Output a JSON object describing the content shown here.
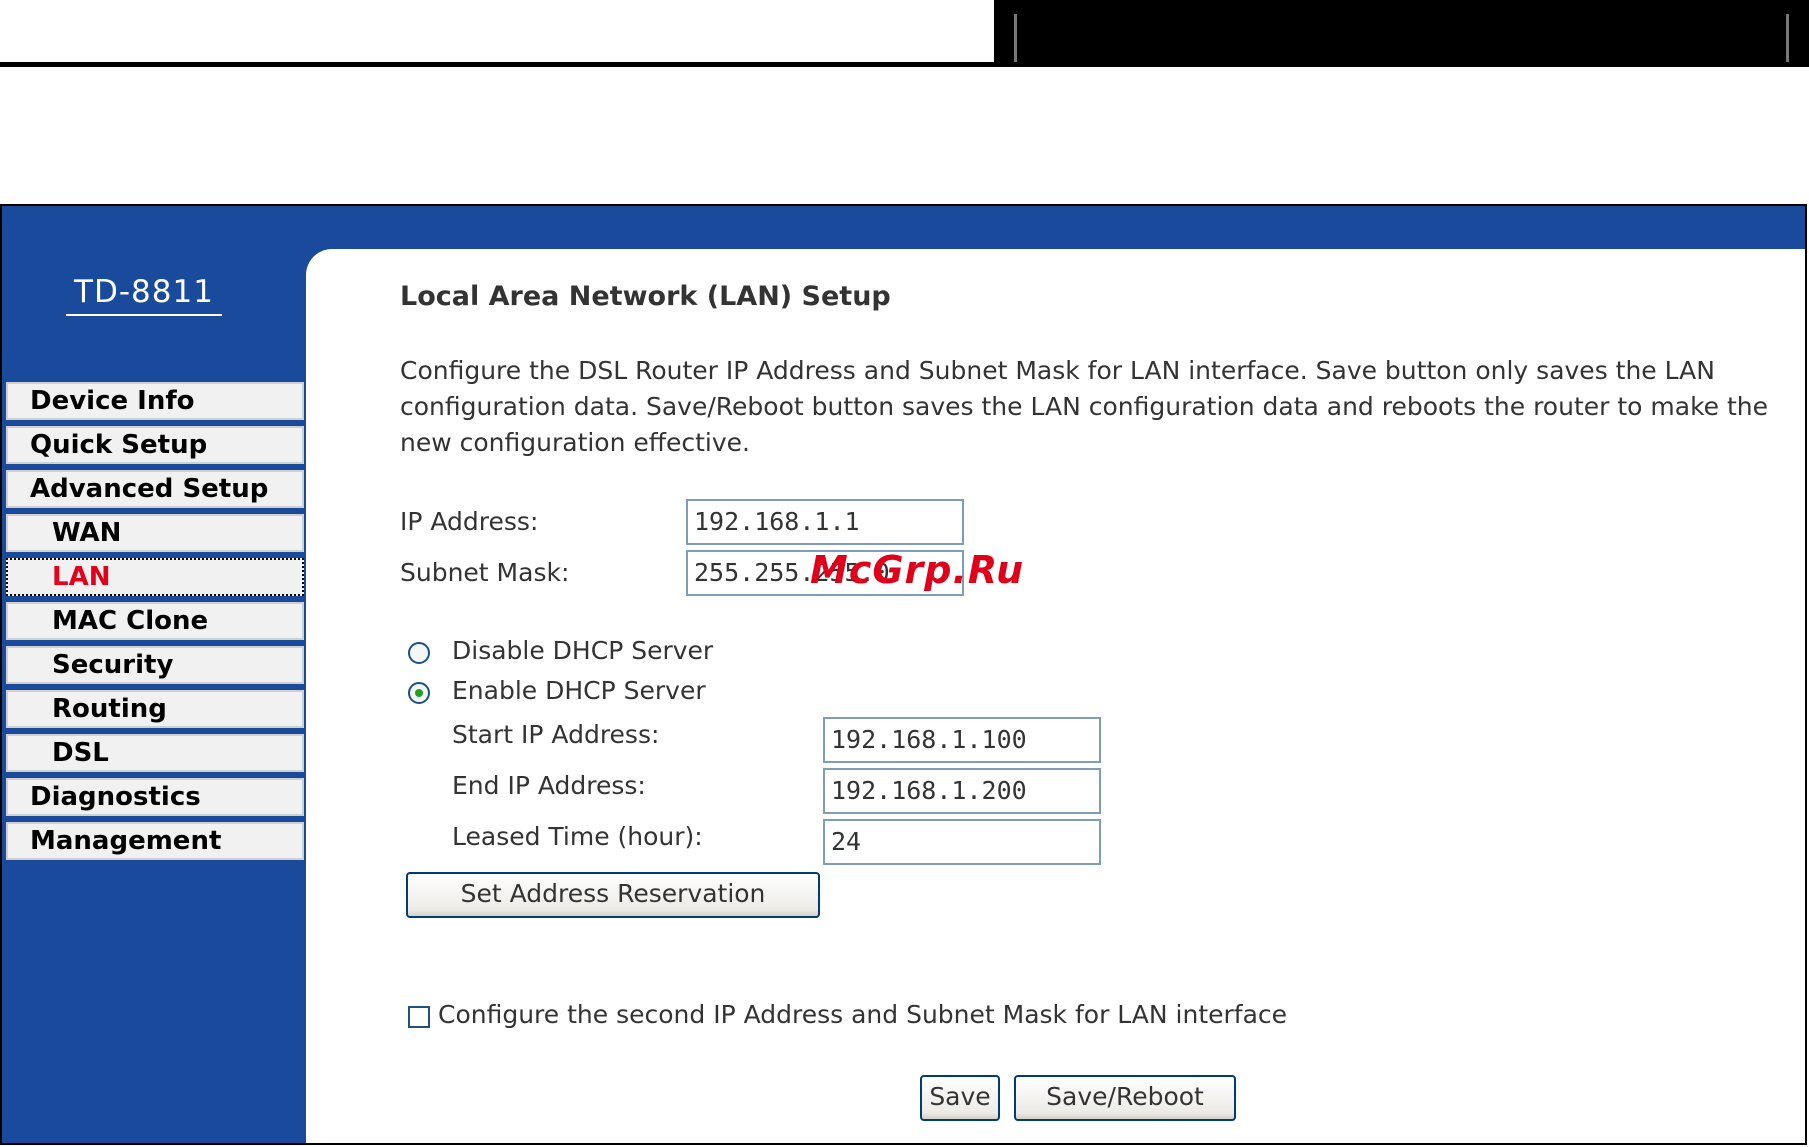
{
  "sidebar": {
    "model": "TD-8811",
    "items": [
      {
        "label": "Device Info"
      },
      {
        "label": "Quick Setup"
      },
      {
        "label": "Advanced Setup"
      },
      {
        "label": "WAN"
      },
      {
        "label": "LAN"
      },
      {
        "label": "MAC Clone"
      },
      {
        "label": "Security"
      },
      {
        "label": "Routing"
      },
      {
        "label": "DSL"
      },
      {
        "label": "Diagnostics"
      },
      {
        "label": "Management"
      }
    ],
    "active_item": "LAN"
  },
  "main": {
    "title": "Local Area Network (LAN) Setup",
    "description": "Configure the DSL Router IP Address and Subnet Mask for LAN interface.  Save button only saves the LAN configuration data.  Save/Reboot button saves the LAN configuration data and reboots the router to make the new configuration effective.",
    "ip_address": {
      "label": "IP Address:",
      "value": "192.168.1.1"
    },
    "subnet_mask": {
      "label": "Subnet Mask:",
      "value": "255.255.255.0"
    },
    "dhcp": {
      "disable_label": "Disable DHCP Server",
      "enable_label": "Enable DHCP Server",
      "selected": "enable",
      "start_ip": {
        "label": "Start IP Address:",
        "value": "192.168.1.100"
      },
      "end_ip": {
        "label": "End IP Address:",
        "value": "192.168.1.200"
      },
      "leased_time": {
        "label": "Leased Time (hour):",
        "value": "24"
      }
    },
    "reservation_button": "Set Address Reservation",
    "second_ip_checkbox": {
      "label": "Configure the second IP Address and Subnet Mask for LAN interface",
      "checked": false
    },
    "save_button": "Save",
    "save_reboot_button": "Save/Reboot"
  },
  "watermark": "McGrp.Ru",
  "colors": {
    "frame_blue": "#1a4a9c",
    "active_red": "#e4001b",
    "radio_green": "#21a121"
  }
}
